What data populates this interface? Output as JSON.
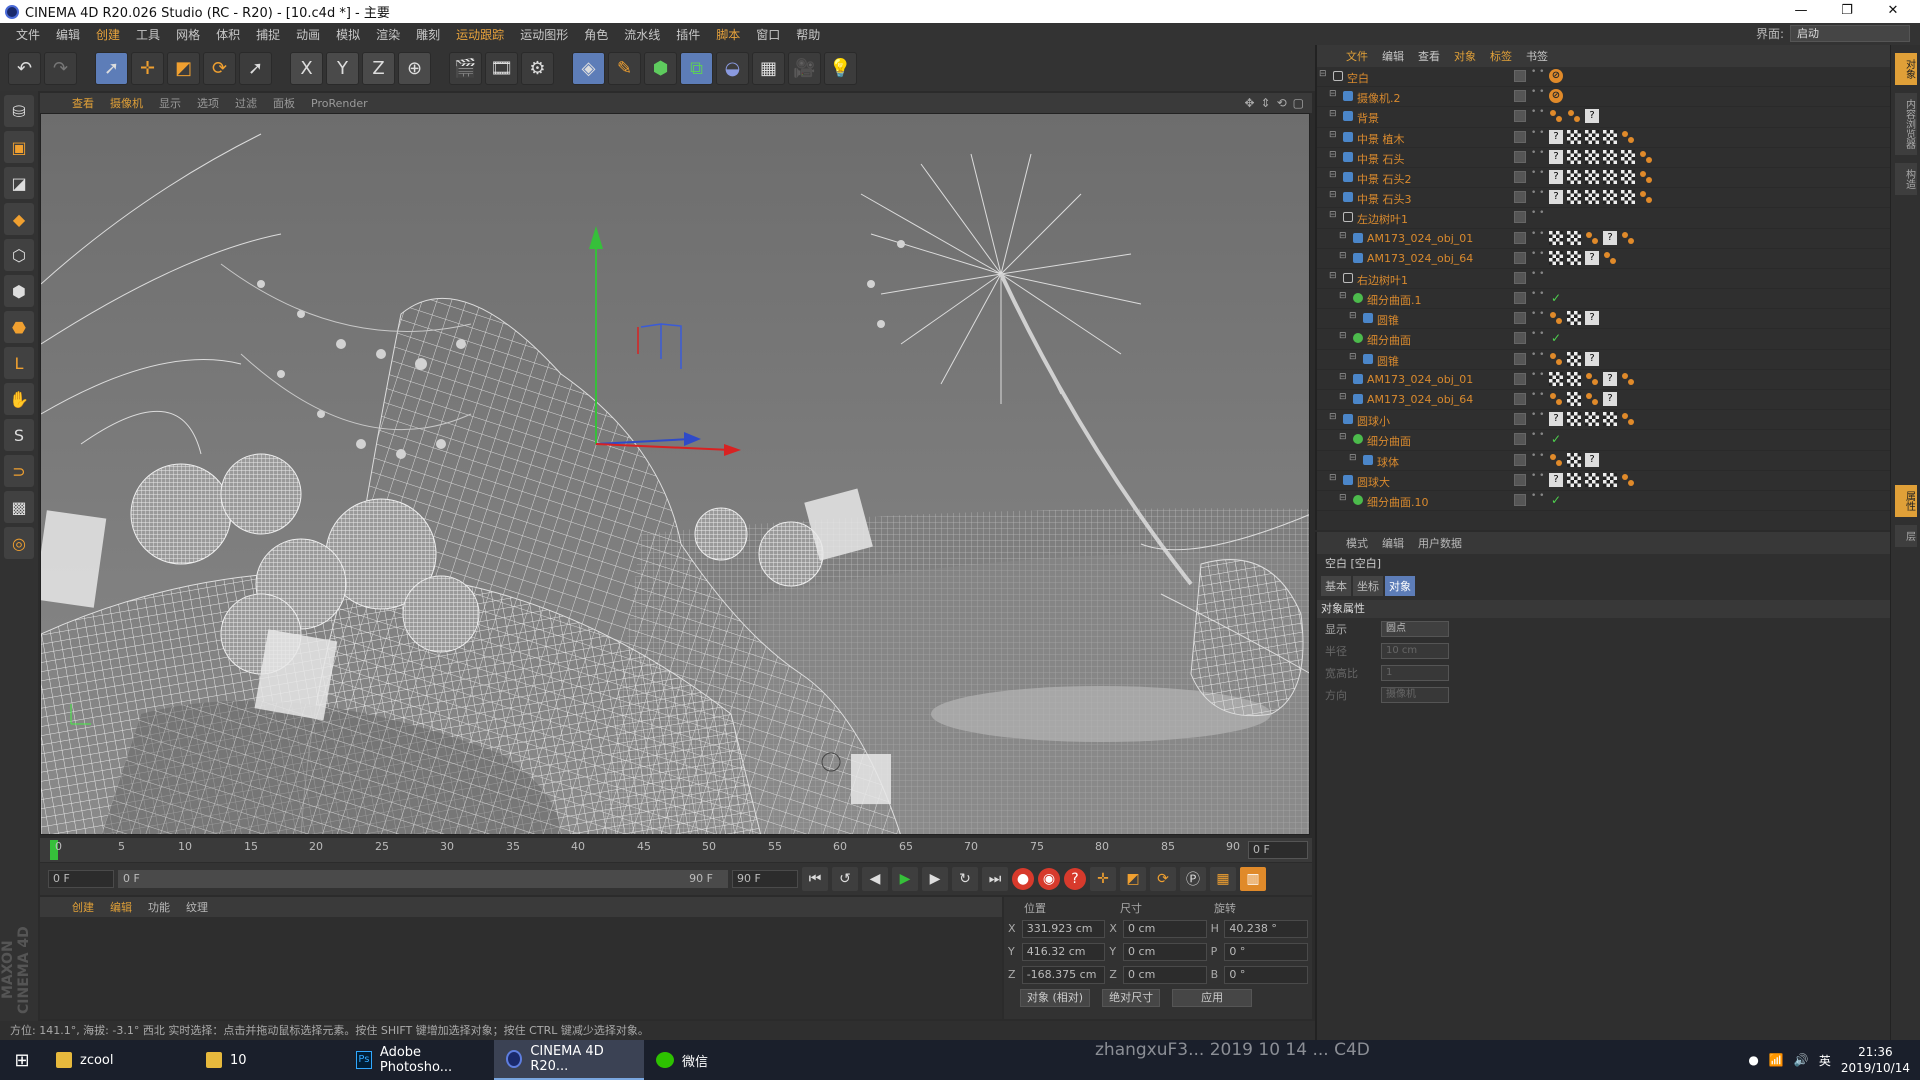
{
  "title": "CINEMA 4D R20.026 Studio (RC - R20) - [10.c4d *] - 主要",
  "window_buttons": {
    "min": "—",
    "max": "❐",
    "close": "✕"
  },
  "menu": [
    "文件",
    "编辑",
    "创建",
    "工具",
    "网格",
    "体积",
    "捕捉",
    "动画",
    "模拟",
    "渲染",
    "雕刻",
    "运动跟踪",
    "运动图形",
    "角色",
    "流水线",
    "插件",
    "脚本",
    "窗口",
    "帮助"
  ],
  "interface_label": "界面:",
  "interface_value": "启动",
  "toolbar_axes": [
    "X",
    "Y",
    "Z"
  ],
  "viewport_menu": [
    "查看",
    "摄像机",
    "显示",
    "选项",
    "过滤",
    "面板",
    "ProRender"
  ],
  "timeline": {
    "ticks": [
      "0",
      "5",
      "10",
      "15",
      "20",
      "25",
      "30",
      "35",
      "40",
      "45",
      "50",
      "55",
      "60",
      "65",
      "70",
      "75",
      "80",
      "85",
      "90"
    ],
    "frame": "0 F"
  },
  "transport": {
    "start": "0 F",
    "range_start": "0 F",
    "range_end": "90 F",
    "end": "90 F"
  },
  "material_tabs": [
    "创建",
    "编辑",
    "功能",
    "纹理"
  ],
  "coords": {
    "headers": [
      "位置",
      "尺寸",
      "旋转"
    ],
    "rows": [
      {
        "pl": "X",
        "pos": "331.923 cm",
        "sl": "X",
        "size": "0 cm",
        "rl": "H",
        "rot": "40.238 °"
      },
      {
        "pl": "Y",
        "pos": "416.32 cm",
        "sl": "Y",
        "size": "0 cm",
        "rl": "P",
        "rot": "0 °"
      },
      {
        "pl": "Z",
        "pos": "-168.375 cm",
        "sl": "Z",
        "size": "0 cm",
        "rl": "B",
        "rot": "0 °"
      }
    ],
    "mode1": "对象 (相对)",
    "mode2": "绝对尺寸",
    "apply": "应用"
  },
  "status": "方位: 141.1°, 海拔: -3.1° 西北   实时选择：点击并拖动鼠标选择元素。按住 SHIFT 键增加选择对象；按住 CTRL 键减少选择对象。",
  "object_manager": {
    "menu": [
      "文件",
      "编辑",
      "查看",
      "对象",
      "标签",
      "书签"
    ],
    "rows": [
      {
        "name": "空白",
        "indent": 0,
        "icon": "n",
        "tags": [
          "x"
        ]
      },
      {
        "name": "摄像机.2",
        "indent": 1,
        "icon": "b",
        "tags": [
          "x"
        ]
      },
      {
        "name": "背景",
        "indent": 1,
        "icon": "b",
        "tags": [
          "o",
          "o",
          "q"
        ]
      },
      {
        "name": "中景 植木",
        "indent": 1,
        "icon": "b",
        "tags": [
          "q",
          "c",
          "c",
          "c",
          "o"
        ]
      },
      {
        "name": "中景 石头",
        "indent": 1,
        "icon": "b",
        "tags": [
          "q",
          "c",
          "c",
          "c",
          "c",
          "o"
        ]
      },
      {
        "name": "中景 石头2",
        "indent": 1,
        "icon": "b",
        "tags": [
          "q",
          "c",
          "c",
          "c",
          "c",
          "o"
        ]
      },
      {
        "name": "中景 石头3",
        "indent": 1,
        "icon": "b",
        "tags": [
          "q",
          "c",
          "c",
          "c",
          "c",
          "o"
        ]
      },
      {
        "name": "左边树叶1",
        "indent": 1,
        "icon": "n",
        "tags": []
      },
      {
        "name": "AM173_024_obj_01",
        "indent": 2,
        "icon": "b",
        "tags": [
          "c",
          "c",
          "o",
          "q",
          "o"
        ]
      },
      {
        "name": "AM173_024_obj_64",
        "indent": 2,
        "icon": "b",
        "tags": [
          "c",
          "c",
          "q",
          "o"
        ]
      },
      {
        "name": "右边树叶1",
        "indent": 1,
        "icon": "n",
        "tags": []
      },
      {
        "name": "细分曲面.1",
        "indent": 2,
        "icon": "g",
        "tags": [
          "k"
        ]
      },
      {
        "name": "圆锥",
        "indent": 3,
        "icon": "b",
        "tags": [
          "o",
          "c",
          "q"
        ]
      },
      {
        "name": "细分曲面",
        "indent": 2,
        "icon": "g",
        "tags": [
          "k"
        ]
      },
      {
        "name": "圆锥",
        "indent": 3,
        "icon": "b",
        "tags": [
          "o",
          "c",
          "q"
        ]
      },
      {
        "name": "AM173_024_obj_01",
        "indent": 2,
        "icon": "b",
        "tags": [
          "c",
          "c",
          "o",
          "q",
          "o"
        ]
      },
      {
        "name": "AM173_024_obj_64",
        "indent": 2,
        "icon": "b",
        "tags": [
          "o",
          "c",
          "o",
          "q"
        ]
      },
      {
        "name": "圆球小",
        "indent": 1,
        "icon": "b",
        "tags": [
          "q",
          "c",
          "c",
          "c",
          "o"
        ]
      },
      {
        "name": "细分曲面",
        "indent": 2,
        "icon": "g",
        "tags": [
          "k"
        ]
      },
      {
        "name": "球体",
        "indent": 3,
        "icon": "b",
        "tags": [
          "o",
          "c",
          "q"
        ]
      },
      {
        "name": "圆球大",
        "indent": 1,
        "icon": "b",
        "tags": [
          "q",
          "c",
          "c",
          "c",
          "o"
        ]
      },
      {
        "name": "细分曲面.10",
        "indent": 2,
        "icon": "g",
        "tags": [
          "k"
        ]
      }
    ]
  },
  "attr_manager": {
    "menu": [
      "模式",
      "编辑",
      "用户数据"
    ],
    "name": "空白 [空白]",
    "tabs": [
      "基本",
      "坐标",
      "对象"
    ],
    "section": "对象属性",
    "rows": [
      {
        "label": "显示",
        "value": "圆点",
        "dim": false
      },
      {
        "label": "半径",
        "value": "10 cm",
        "dim": true
      },
      {
        "label": "宽高比",
        "value": "1",
        "dim": true
      },
      {
        "label": "方向",
        "value": "摄像机",
        "dim": true
      }
    ]
  },
  "right_tabs": [
    "对象",
    "内容浏览器",
    "构造"
  ],
  "right_tabs2": [
    "属性",
    "层"
  ],
  "maxon": "MAXON CINEMA 4D",
  "taskbar": {
    "items": [
      {
        "label": "zcool",
        "icon": "folder"
      },
      {
        "label": "10",
        "icon": "folder"
      },
      {
        "label": "Adobe Photosho...",
        "icon": "ps"
      },
      {
        "label": "CINEMA 4D R20...",
        "icon": "c4d"
      },
      {
        "label": "微信",
        "icon": "wechat"
      }
    ],
    "ime": "英",
    "time": "21:36",
    "date": "2019/10/14",
    "watermark": "zhangxuF3... 2019 10 14 ... C4D"
  },
  "colors": {
    "accent": "#e0a038",
    "selected": "#5d7db8",
    "green_axis": "#36c03a"
  }
}
